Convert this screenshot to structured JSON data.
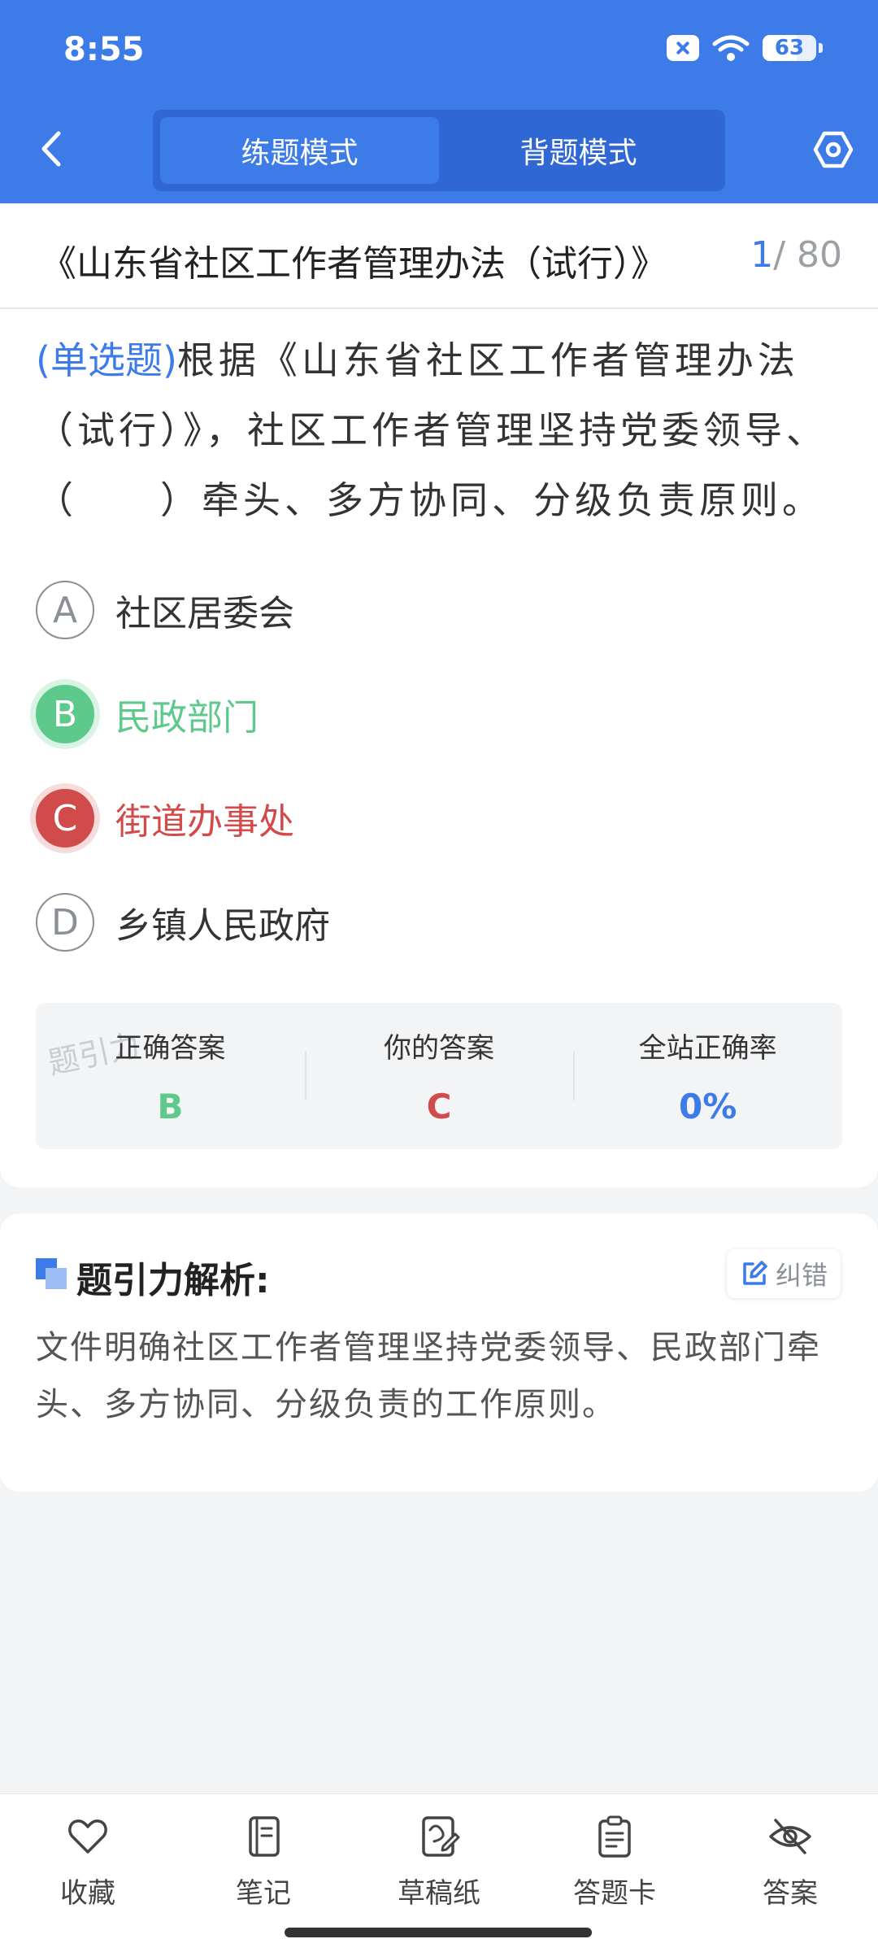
{
  "status_bar": {
    "time": "8:55",
    "battery": "63",
    "battery_level_percent": 63
  },
  "header": {
    "modes": [
      {
        "label": "练题模式",
        "active": true
      },
      {
        "label": "背题模式",
        "active": false
      }
    ]
  },
  "document": {
    "title": "《山东省社区工作者管理办法（试行）》",
    "current": "1",
    "total": "/ 80"
  },
  "question": {
    "type": "(单选题)",
    "text": "根据《山东省社区工作者管理办法（试行）》，社区工作者管理坚持党委领导、（　　）牵头、多方协同、分级负责原则。",
    "options": [
      {
        "letter": "A",
        "text": "社区居委会",
        "state": "normal"
      },
      {
        "letter": "B",
        "text": "民政部门",
        "state": "correct"
      },
      {
        "letter": "C",
        "text": "街道办事处",
        "state": "wrong"
      },
      {
        "letter": "D",
        "text": "乡镇人民政府",
        "state": "normal"
      }
    ]
  },
  "stats": {
    "watermark": "题引力",
    "correct_label": "正确答案",
    "correct_value": "B",
    "yours_label": "你的答案",
    "yours_value": "C",
    "rate_label": "全站正确率",
    "rate_value": "0%"
  },
  "analysis": {
    "title": "题引力解析:",
    "report_label": "纠错",
    "text": "文件明确社区工作者管理坚持党委领导、民政部门牵头、多方协同、分级负责的工作原则。"
  },
  "bottom_nav": [
    {
      "label": "收藏",
      "icon": "heart-icon"
    },
    {
      "label": "笔记",
      "icon": "notebook-icon"
    },
    {
      "label": "草稿纸",
      "icon": "draft-icon"
    },
    {
      "label": "答题卡",
      "icon": "answer-card-icon"
    },
    {
      "label": "答案",
      "icon": "eye-off-icon"
    }
  ],
  "colors": {
    "primary": "#3d7be8",
    "correct": "#5dc98b",
    "wrong": "#d24b4b"
  }
}
